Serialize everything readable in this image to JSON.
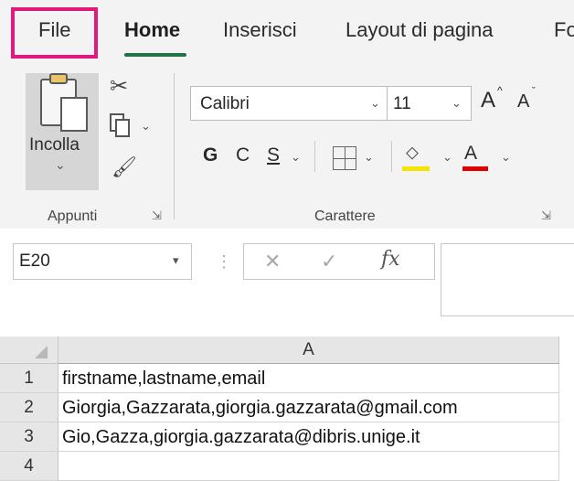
{
  "ribbon_tabs": {
    "file": "File",
    "home": "Home",
    "insert": "Inserisci",
    "layout": "Layout di pagina",
    "cut_off": "Fo"
  },
  "clipboard": {
    "paste_label": "Incolla",
    "group_label": "Appunti"
  },
  "font": {
    "name": "Calibri",
    "size": "11",
    "bold": "G",
    "italic": "C",
    "underline": "S",
    "group_label": "Carattere",
    "grow": "A",
    "shrink": "A",
    "font_color": "A"
  },
  "formula_bar": {
    "name_box": "E20",
    "fx": "fx",
    "formula": ""
  },
  "sheet": {
    "columns": [
      "A"
    ],
    "rows": [
      {
        "num": "1",
        "a": "firstname,lastname,email"
      },
      {
        "num": "2",
        "a": "Giorgia,Gazzarata,giorgia.gazzarata@gmail.com"
      },
      {
        "num": "3",
        "a": "Gio,Gazza,giorgia.gazzarata@dibris.unige.it"
      },
      {
        "num": "4",
        "a": ""
      }
    ]
  },
  "colors": {
    "accent": "#217346",
    "highlight": "#e0197d",
    "fill_yellow": "#f5e400",
    "font_red": "#e00000"
  }
}
